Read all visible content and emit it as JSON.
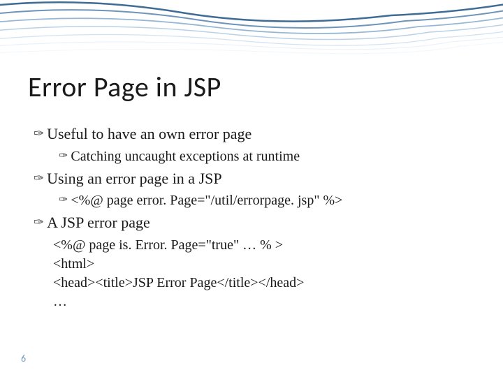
{
  "title": "Error Page in JSP",
  "bullets": [
    {
      "text": "Useful to have an own error page",
      "sub": [
        {
          "text": "Catching uncaught exceptions at runtime"
        }
      ]
    },
    {
      "text": "Using an error page in a JSP",
      "sub": [
        {
          "text": "<%@ page error. Page=\"/util/errorpage. jsp\" %>"
        }
      ]
    },
    {
      "text": "A JSP error page",
      "code": [
        "<%@ page is. Error. Page=\"true\" … % >",
        "<html>",
        "<head><title>JSP Error Page</title></head>",
        "…"
      ]
    }
  ],
  "pageNumber": "6"
}
